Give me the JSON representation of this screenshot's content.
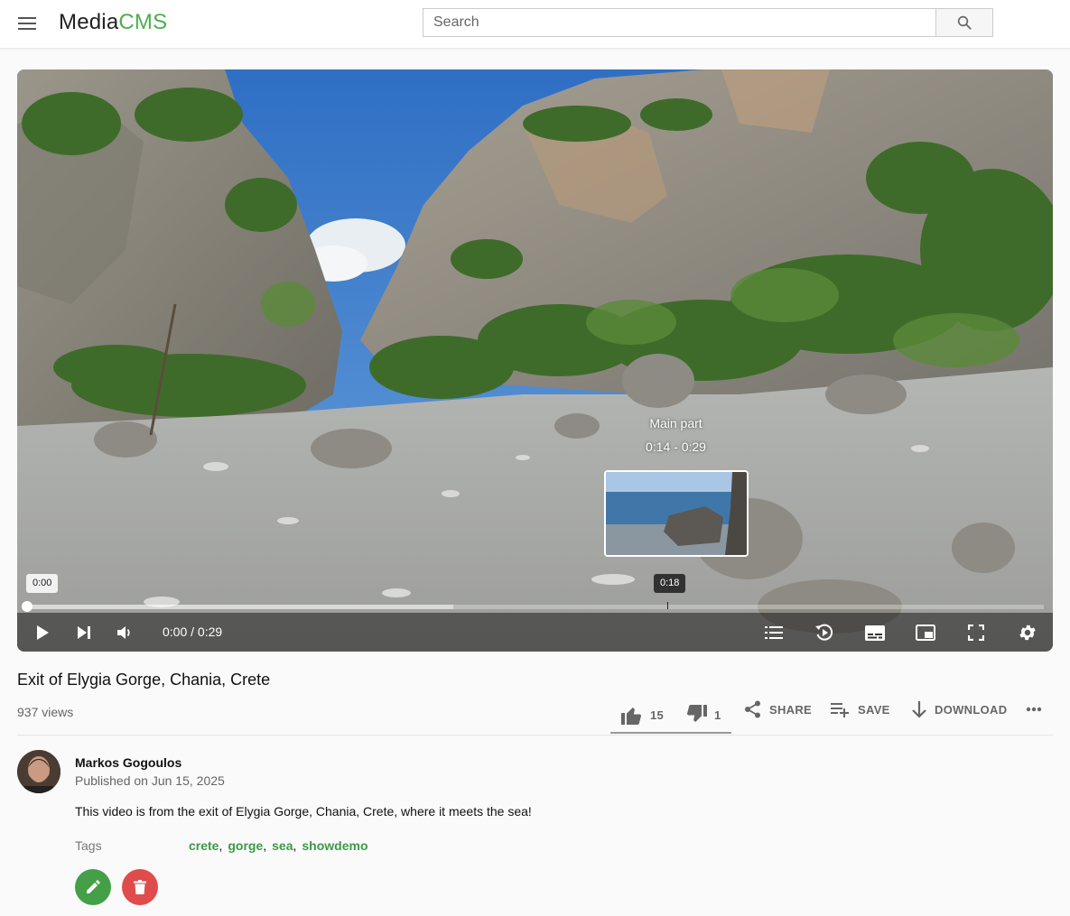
{
  "header": {
    "logo_part1": "Media",
    "logo_part2": "CMS",
    "search_placeholder": "Search"
  },
  "player": {
    "chapter_title": "Main part",
    "chapter_range": "0:14 - 0:29",
    "start_tooltip": "0:00",
    "hover_tooltip": "0:18",
    "time_display": "0:00 / 0:29",
    "hover_fraction": 0.63,
    "loaded_fraction": 0.42
  },
  "media": {
    "title": "Exit of Elygia Gorge, Chania, Crete",
    "views": "937 views",
    "likes": "15",
    "dislikes": "1",
    "share_label": "SHARE",
    "save_label": "SAVE",
    "download_label": "DOWNLOAD"
  },
  "author": {
    "name": "Markos Gogoulos",
    "published": "Published on Jun 15, 2025"
  },
  "description": "This video is from the exit of Elygia Gorge, Chania, Crete, where it meets the sea!",
  "tags_label": "Tags",
  "tags": [
    "crete",
    "gorge",
    "sea",
    "showdemo"
  ],
  "colors": {
    "brand_green": "#4caf50",
    "tag_green": "#3c9a47",
    "edit_button": "#43a047",
    "delete_button": "#e04b4b"
  }
}
